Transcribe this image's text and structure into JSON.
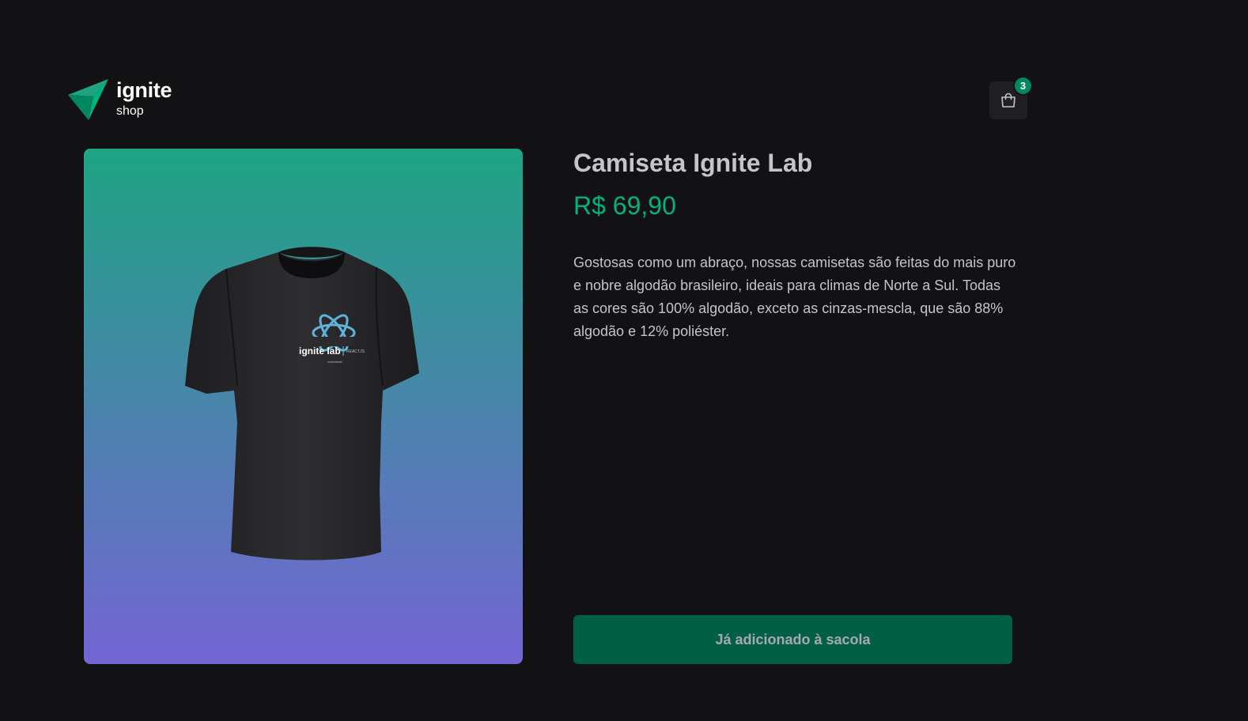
{
  "header": {
    "logo_title": "ignite",
    "logo_subtitle": "shop",
    "cart": {
      "icon": "handbag-icon",
      "badge_count": "3"
    }
  },
  "product": {
    "title": "Camiseta Ignite Lab",
    "price": "R$ 69,90",
    "description": "Gostosas como um abraço, nossas camisetas são feitas do mais puro e nobre algodão brasileiro, ideais para climas de Norte a Sul. Todas as cores são 100% algodão, exceto as cinzas-mescla, que são 88% algodão e 12% poliéster.",
    "image": {
      "print_text": "ignite lab",
      "print_subtext": "REACTJS",
      "print_brand": "rocketseat"
    },
    "button_label": "Já adicionado à sacola"
  },
  "colors": {
    "background": "#121214",
    "brand_green": "#00875f",
    "price_green": "#00b37e",
    "button_bg": "#015f43",
    "gradient_top": "#1ea483",
    "gradient_bottom": "#7465d4"
  }
}
